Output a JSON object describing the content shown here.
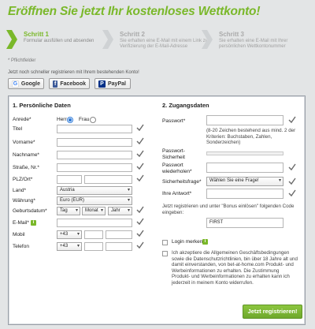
{
  "page": {
    "title": "Eröffnen Sie jetzt Ihr kostenloses Wettkonto!",
    "pflicht": "* Pflichtfelder",
    "schneller": "Jetzt noch schneller registrieren mit Ihrem bestehenden Konto!"
  },
  "steps": [
    {
      "title": "Schritt 1",
      "desc": "Formular ausfüllen und absenden",
      "active": true
    },
    {
      "title": "Schritt 2",
      "desc": "Sie erhalten eine E-Mail mit einem Link zur Verifizierung der E-Mail-Adresse",
      "active": false
    },
    {
      "title": "Schritt 3",
      "desc": "Sie erhalten eine E-Mail mit Ihrer persönlichen Wettkontonummer",
      "active": false
    }
  ],
  "social": {
    "google": "Google",
    "facebook": "Facebook",
    "paypal": "PayPal"
  },
  "personal": {
    "heading": "1. Persönliche Daten",
    "anrede": "Anrede*",
    "herr": "Herr",
    "frau": "Frau",
    "titel": "Titel",
    "vorname": "Vorname*",
    "nachname": "Nachname*",
    "strasse": "Straße, Nr.*",
    "plz": "PLZ/Ort*",
    "land": "Land*",
    "land_value": "Austria",
    "waehrung": "Währung*",
    "waehrung_value": "Euro (EUR)",
    "geburtsdatum": "Geburtsdatum*",
    "tag": "Tag",
    "monat": "Monat",
    "jahr": "Jahr",
    "email": "E-Mail*",
    "mobil": "Mobil",
    "mobil_prefix": "+43",
    "telefon": "Telefon",
    "telefon_prefix": "+43"
  },
  "access": {
    "heading": "2. Zugangsdaten",
    "passwort": "Passwort*",
    "passwort_hint": "(8-20 Zeichen bestehend aus mind. 2 der Kriterien: Buchstaben, Zahlen, Sonderzeichen)",
    "sicherheit": "Passwort-Sicherheit",
    "wiederholen": "Passwort wiederholen*",
    "frage": "Sicherheitsfrage*",
    "frage_value": "Wählen Sie eine Frage!",
    "antwort": "Ihre Antwort*",
    "bonus_text": "Jetzt registrieren und unter \"Bonus einlösen\" folgenden Code eingeben:",
    "bonus_code": "FIRST",
    "login_merken": "Login merken",
    "agb": "Ich akzeptiere die Allgemeinen Geschäftsbedingungen sowie die Datenschutzrichtlinien, bin über 18 Jahre alt und damit einverstanden, von bet-at-home.com Produkt- und Werbeinformationen zu erhalten. Die Zustimmung Produkt- und Werbeinformationen zu erhalten kann ich jederzeit in meinem Konto widerrufen."
  },
  "submit": "Jetzt registrieren!",
  "colors": {
    "brand_green": "#7ab82a",
    "facebook_blue": "#3b5998",
    "paypal_blue": "#003087",
    "radio_blue": "#2f7bd9"
  }
}
